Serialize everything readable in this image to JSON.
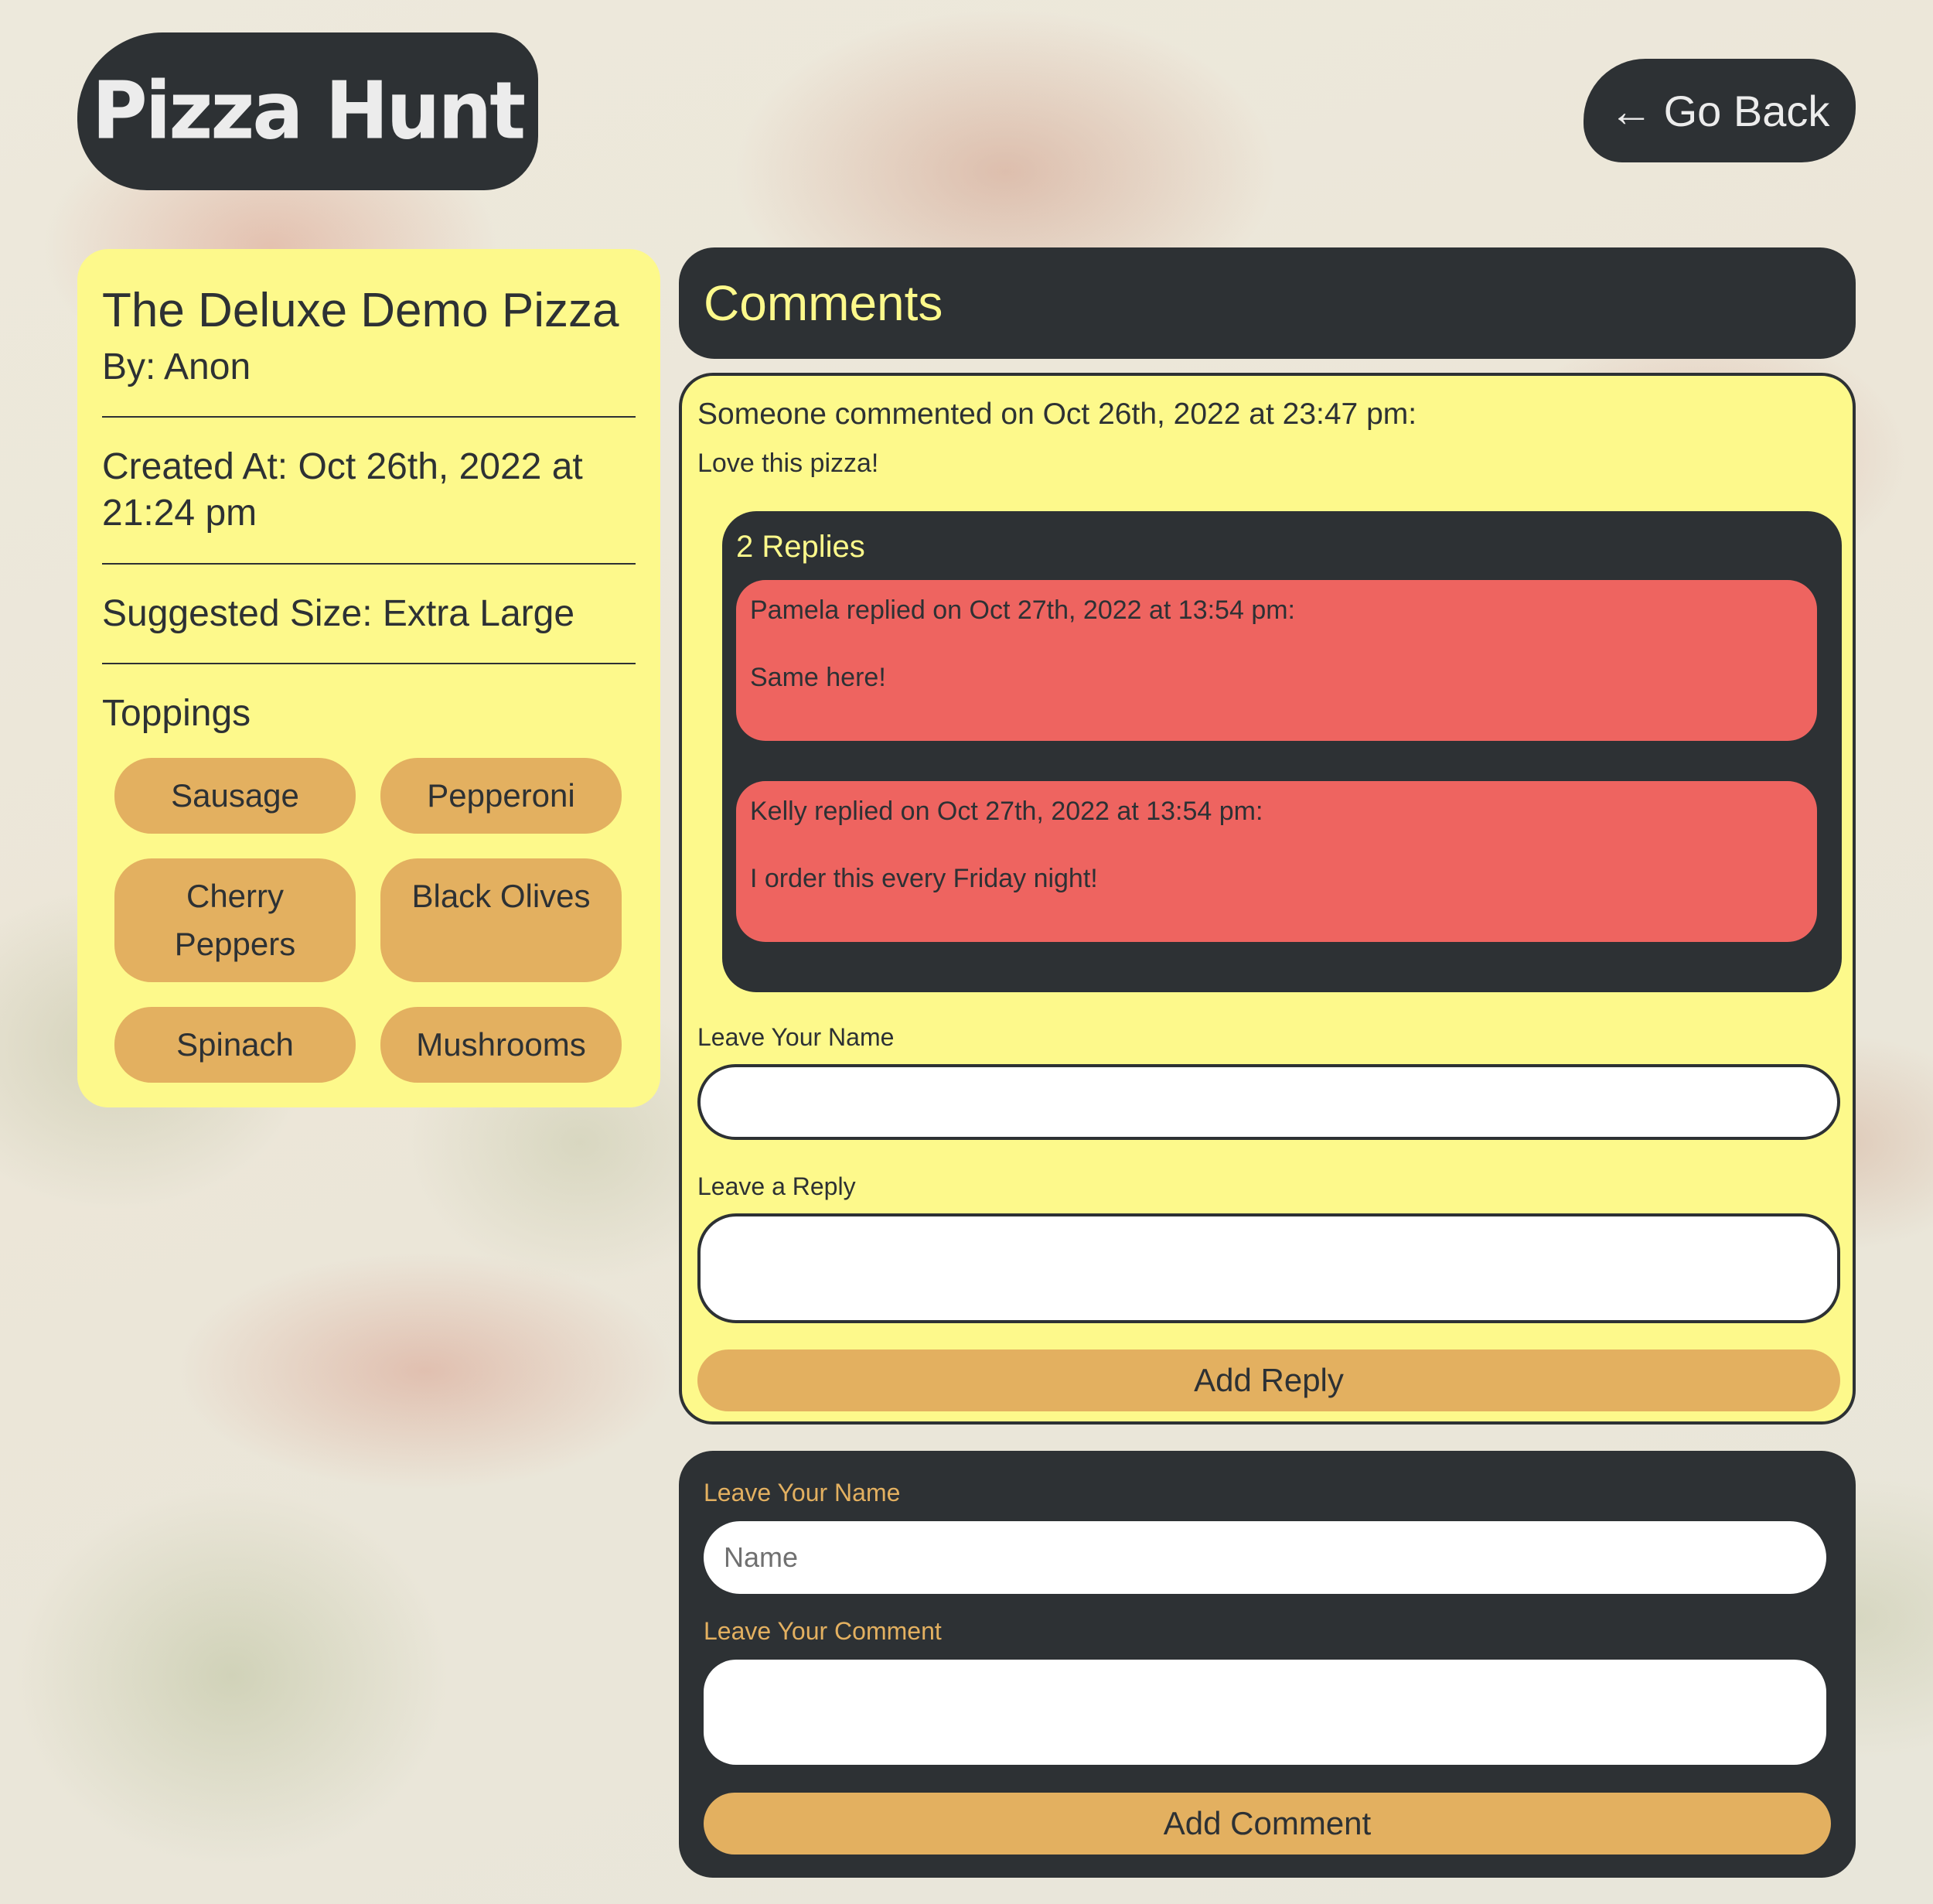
{
  "header": {
    "logo_text": "Pizza Hunt",
    "back_arrow": "←",
    "back_label": "Go Back"
  },
  "pizza": {
    "title": "The Deluxe Demo Pizza",
    "by": "By: Anon",
    "created": "Created At: Oct 26th, 2022 at 21:24 pm",
    "size": "Suggested Size: Extra Large",
    "toppings_heading": "Toppings",
    "toppings": [
      "Sausage",
      "Pepperoni",
      "Cherry Peppers",
      "Black Olives",
      "Spinach",
      "Mushrooms"
    ]
  },
  "comments": {
    "heading": "Comments",
    "items": [
      {
        "meta": "Someone commented on Oct 26th, 2022 at 23:47 pm:",
        "body": "Love this pizza!",
        "replies_count": "2 Replies",
        "replies": [
          {
            "meta": "Pamela replied on Oct 27th, 2022 at 13:54 pm:",
            "text": "Same here!"
          },
          {
            "meta": "Kelly replied on Oct 27th, 2022 at 13:54 pm:",
            "text": "I order this every Friday night!"
          }
        ],
        "reply_form": {
          "name_label": "Leave Your Name",
          "name_value": "",
          "reply_label": "Leave a Reply",
          "reply_value": "",
          "button": "Add Reply"
        }
      }
    ]
  },
  "comment_form": {
    "name_label": "Leave Your Name",
    "name_placeholder": "Name",
    "comment_label": "Leave Your Comment",
    "comment_value": "",
    "button": "Add Comment"
  },
  "colors": {
    "dark": "#2d3134",
    "yellow": "#fdf98b",
    "orange": "#e3b060",
    "red": "#ee6460"
  }
}
